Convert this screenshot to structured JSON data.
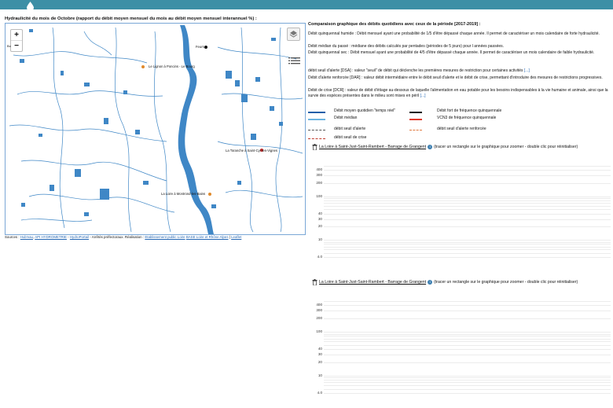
{
  "header": {
    "bar_color": "#3d8fa6",
    "icon": "drop-icon"
  },
  "map": {
    "title": "Hydraulicité du mois de Octobre (rapport du débit moyen mensuel du mois au débit moyen mensuel interannuel %) :",
    "zoom_in": "+",
    "zoom_out": "−",
    "scale": "Bo",
    "labels": {
      "l1": "Le Lignon à Poncins - Le Bourg",
      "l2": "La Toranche à Saint-Cyr-les-Vignes",
      "l3": "La Loire à Montrond-les-Bains",
      "l4": "Feurs"
    },
    "water_color": "#3f87c6"
  },
  "sources": {
    "prefix": "Sources :",
    "hubeau": "Hub'eau",
    "api": "API HYDROMETRIE",
    "sep1": " - ",
    "hydroportail": "HydroPortail",
    "arretes": " - Arrêtés préfectoraux. Réalisation :",
    "etab": "Etablissement public Loire",
    "basse": "BASE Loire et Rhône Alpes",
    "leaflet": "Leaflet"
  },
  "right": {
    "title": "Comparaison graphique des débits quotidiens avec ceux de la période [2017-2019] :",
    "p1": "Débit quinquennal humide : Débit mensuel ayant une probabilité de 1/5 d'être dépassé chaque année. Il permet de caractériser un mois calendaire de forte hydraulicité.",
    "p2": "Débit médian du passé : médiane des débits calculés par pentades (périodes de 5 jours) pour l années passées.",
    "p3": "Débit quinquennal sec : Débit mensuel ayant une probabilité de 4/5 d'être dépassé chaque année. Il permet de caractériser un mois calendaire de faible hydraulicité.",
    "p4": "débit seuil d'alerte [DSA] : valeur \"seuil\" de débit qui déclenche les premières mesures de restriction pour certaines activités",
    "p5": "Débit d'alerte renforcée [DAR] : valeur débit intermédiaire entre le débit seuil d'alerte et le débit de crise, permettant d'introduire des mesures de restrictions progressives.",
    "p6": "Débit de crise [DCR] : valeur de débit d'étiage au-dessous de laquelle l'alimentation en eau potable pour les besoins indispensables à la vie humaine et animale, ainsi que la survie des espèces présentes dans le milieu sont mises en péril",
    "more": "[...]",
    "legend": {
      "a": "Débit moyen quotidien \"temps réel\"",
      "b": "Débit fort de fréquence quinquennale",
      "c": "Débit médian",
      "d": "VCN3 de fréquence quinquennale",
      "e": "débit seuil d'alerte",
      "f": "débit seuil d'alerte renforcée",
      "g": "débit seuil de crise"
    },
    "colors": {
      "moyen": "#1f5fa8",
      "fort": "#111111",
      "median": "#6cb4e0",
      "vcn3": "#e03a2c",
      "alerte": "#555555",
      "renforcee": "#e07a40",
      "crise": "#c0392b"
    }
  },
  "graphs": [
    {
      "site": "La Loire à Saint-Just-Saint-Rambert - Barrage de Grangent",
      "hint": "(tracer un rectangle sur le graphique pour zoomer - double clic pour réinitialiser)",
      "ticks": [
        "400",
        "300",
        "200",
        "100",
        "40",
        "30",
        "20",
        "10",
        "4.0"
      ]
    },
    {
      "site": "La Loire à Saint-Just-Saint-Rambert - Barrage de Grangent",
      "hint": "(tracer un rectangle sur le graphique pour zoomer - double clic pour réinitialiser)",
      "ticks": [
        "400",
        "300",
        "200",
        "100",
        "40",
        "30",
        "20",
        "10",
        "4.0"
      ]
    }
  ]
}
